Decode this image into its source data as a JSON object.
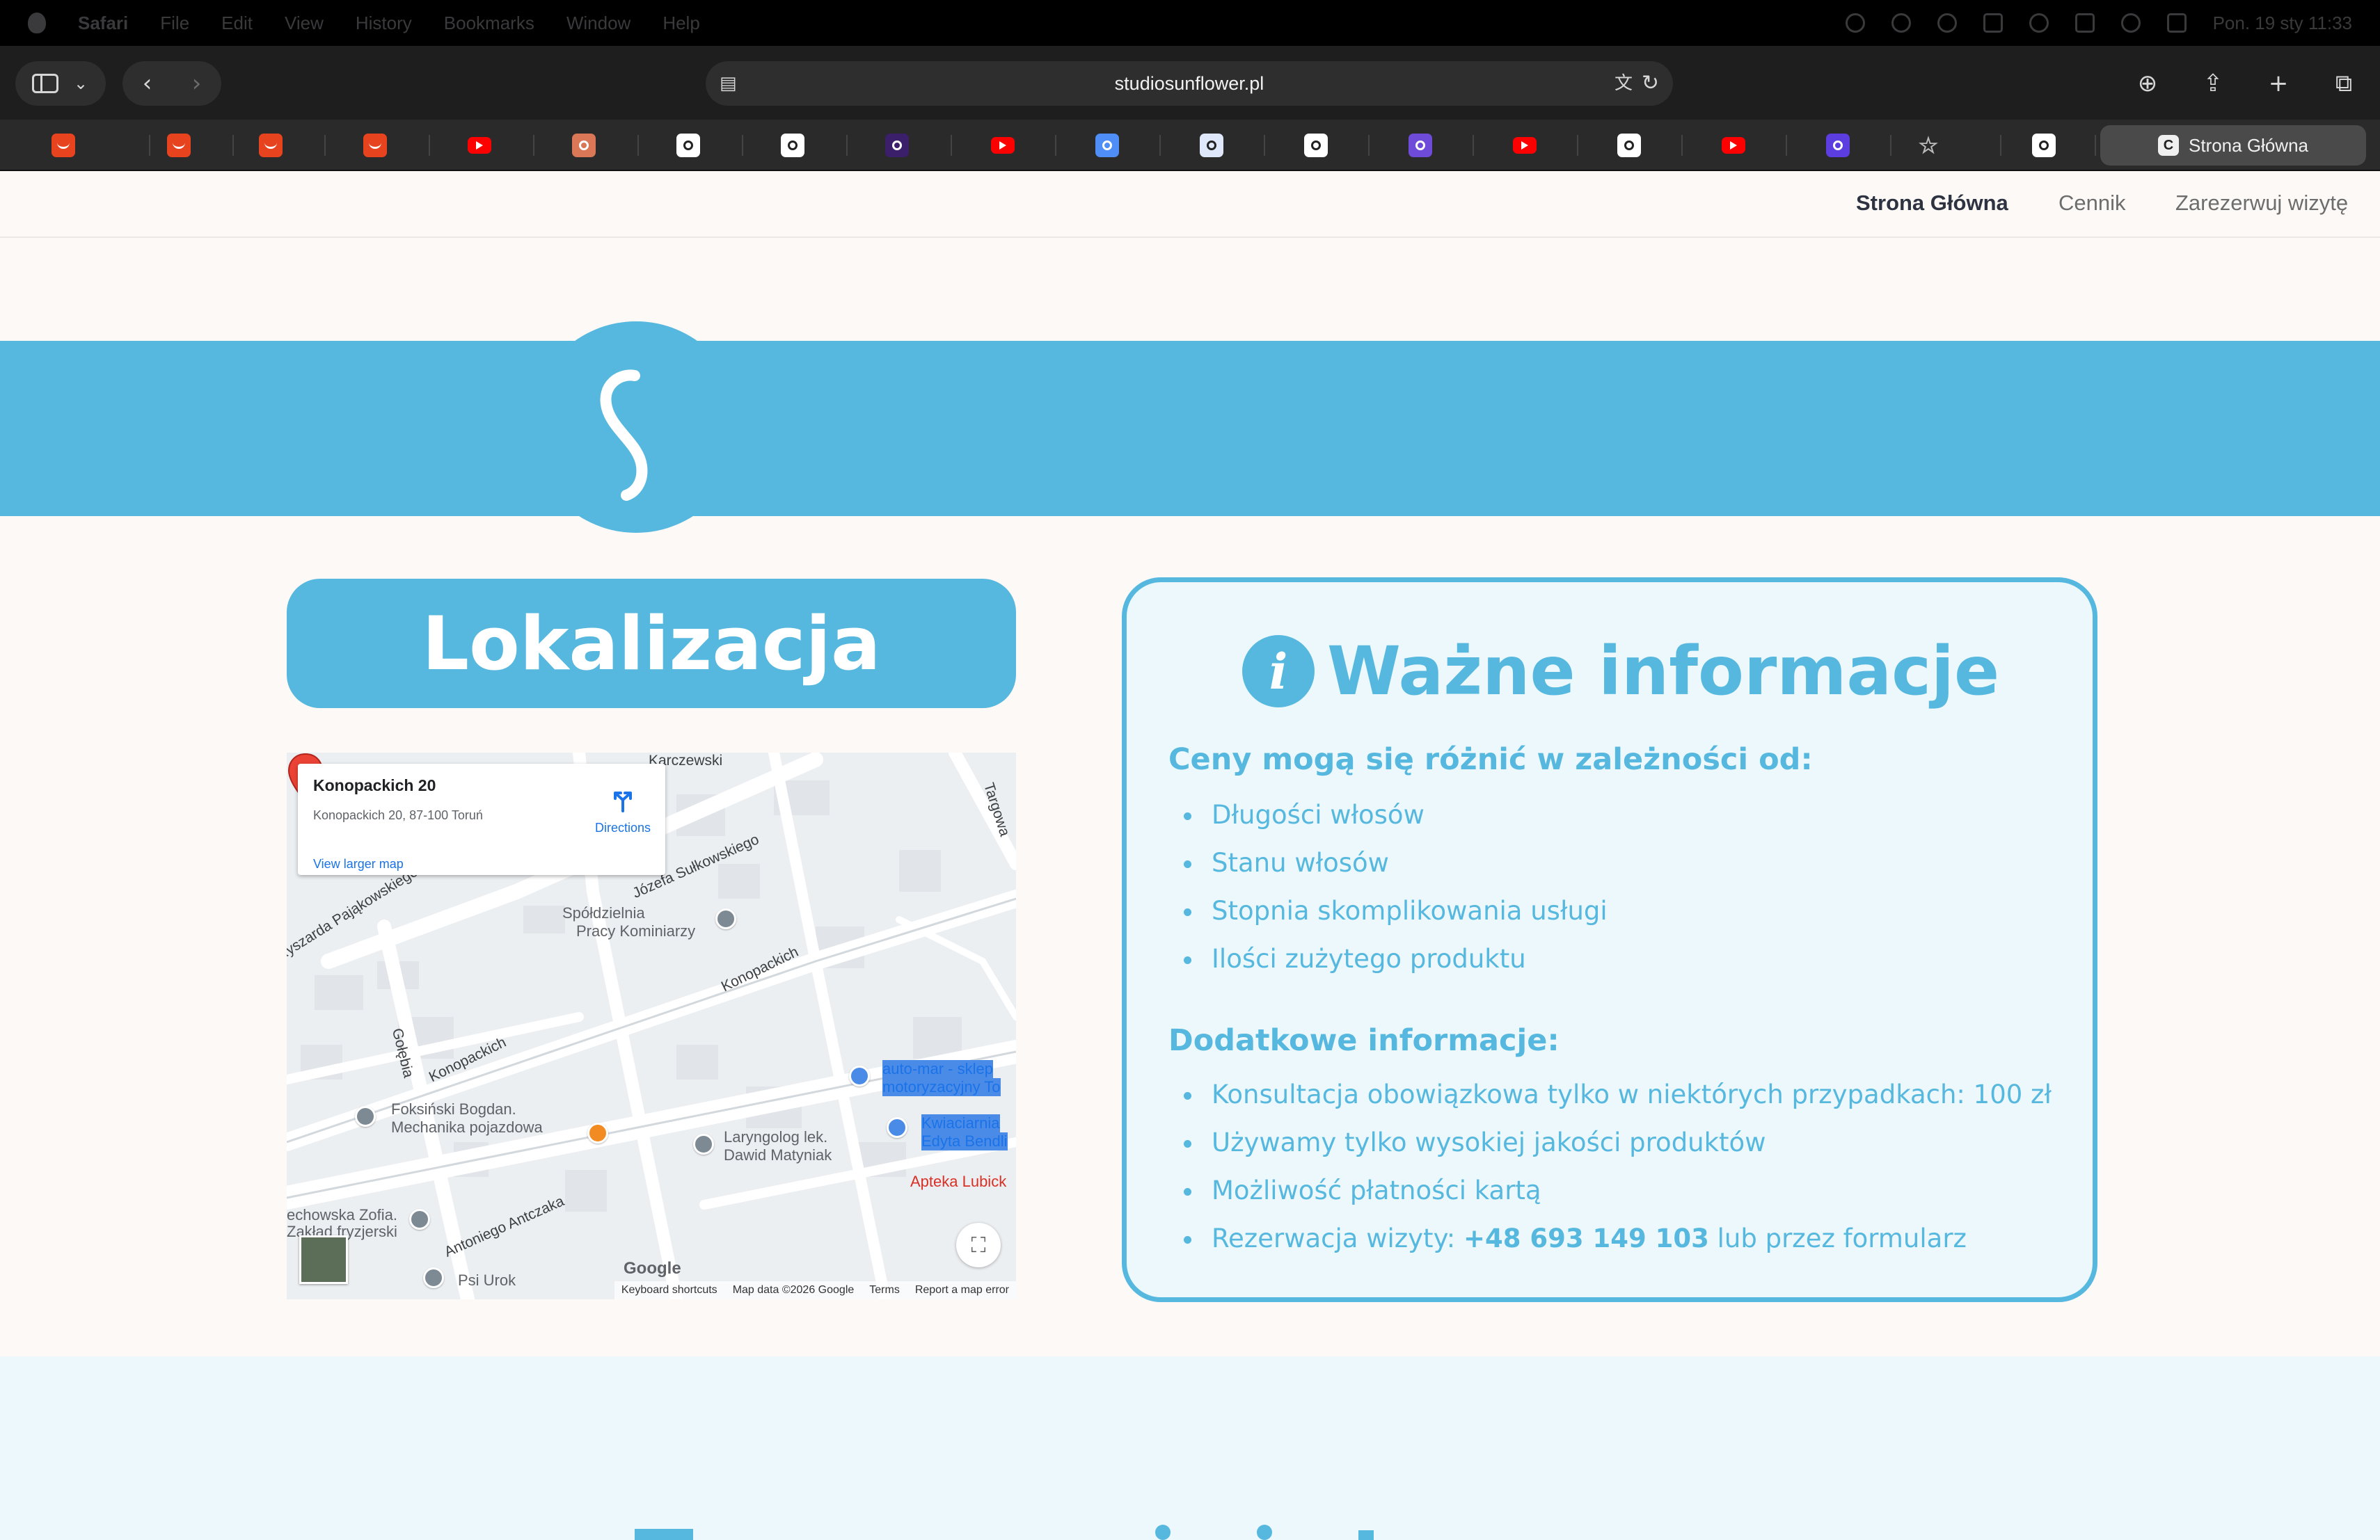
{
  "menubar": {
    "app_name": "Safari",
    "menus": [
      "File",
      "Edit",
      "View",
      "History",
      "Bookmarks",
      "Window",
      "Help"
    ],
    "clock": "Pon. 19 sty  11:33"
  },
  "browser": {
    "url": "studiosunflower.pl",
    "current_tab_title": "Strona Główna",
    "favorites": [
      {
        "icon": "aliexpress-icon",
        "color": "#e8431f"
      },
      {
        "icon": "aliexpress-icon",
        "color": "#e8431f"
      },
      {
        "icon": "aliexpress-icon",
        "color": "#e8431f"
      },
      {
        "icon": "aliexpress-icon",
        "color": "#e8431f"
      },
      {
        "icon": "youtube-icon",
        "color": "#ff0000"
      },
      {
        "icon": "claude-icon",
        "color": "#d97757"
      },
      {
        "icon": "pause-app-icon",
        "color": "#ffffff"
      },
      {
        "icon": "record-app-icon",
        "color": "#ffffff"
      },
      {
        "icon": "app-icon",
        "color": "#3b1f6b"
      },
      {
        "icon": "youtube-icon",
        "color": "#ff0000"
      },
      {
        "icon": "gemini-icon",
        "color": "#4f8df7"
      },
      {
        "icon": "docs-icon",
        "color": "#dfe7fb"
      },
      {
        "icon": "chatgpt-icon",
        "color": "#ffffff"
      },
      {
        "icon": "app-icon",
        "color": "#6e4bd8"
      },
      {
        "icon": "youtube-icon",
        "color": "#ff0000"
      },
      {
        "icon": "disney-plus-icon",
        "color": "#ffffff"
      },
      {
        "icon": "youtube-icon",
        "color": "#ff0000"
      },
      {
        "icon": "app-icon",
        "color": "#5b3de0"
      },
      {
        "icon": "star-icon",
        "color": "#bbbbbb"
      },
      {
        "icon": "app-icon",
        "color": "#ffffff"
      }
    ]
  },
  "site_nav": {
    "items": [
      {
        "label": "Strona Główna",
        "active": true
      },
      {
        "label": "Cennik",
        "active": false
      },
      {
        "label": "Zarezerwuj wizytę",
        "active": false
      }
    ]
  },
  "hero": {
    "logo_letter": "S"
  },
  "location": {
    "title": "Lokalizacja",
    "map": {
      "place_title": "Konopackich 20",
      "place_address": "Konopackich 20, 87-100 Toruń",
      "directions_label": "Directions",
      "view_larger_label": "View larger map",
      "google_logo": "Google",
      "footer": [
        "Keyboard shortcuts",
        "Map data ©2026 Google",
        "Terms",
        "Report a map error"
      ],
      "streets": [
        "Józefa Sułkowskiego",
        "Konopackich",
        "Konopackich",
        "Gołębia",
        "Antoniego Antczaka",
        "Ryszarda Pająkowskiego",
        "Targowa",
        "Karczewski"
      ],
      "pois": [
        "Spółdzielnia",
        "Pracy Kominiarzy",
        "Foksiński Bogdan.",
        "Mechanika pojazdowa",
        "Laryngolog lek.",
        "Dawid Matyniak",
        "auto-mar - sklep",
        "motoryzacyjny To",
        "Kwiaciarnia",
        "Edyta Bendli",
        "Apteka Lubick",
        "echowska Zofia.",
        "Zakład fryzjerski",
        "Psi Urok"
      ]
    }
  },
  "info": {
    "title": "Ważne informacje",
    "prices_heading": "Ceny mogą się różnić w zależności od:",
    "prices_items": [
      "Długości włosów",
      "Stanu włosów",
      "Stopnia skomplikowania usługi",
      "Ilości zużytego produktu"
    ],
    "extra_heading": "Dodatkowe informacje:",
    "extra_items": [
      "Konsultacja obowiązkowa tylko w niektórych przypadkach: 100 zł",
      "Używamy tylko wysokiej jakości produktów",
      "Możliwość płatności kartą"
    ],
    "reservation_prefix": "Rezerwacja wizyty: ",
    "reservation_phone": "+48 693 149 103",
    "reservation_suffix": " lub przez formularz"
  }
}
